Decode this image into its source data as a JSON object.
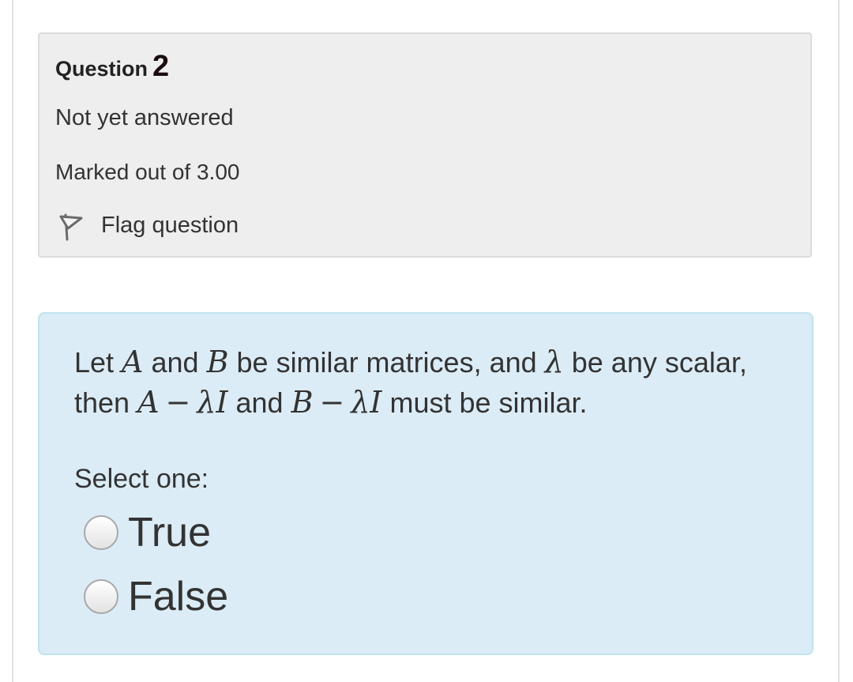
{
  "question": {
    "label": "Question",
    "number": "2",
    "state": "Not yet answered",
    "grade": "Marked out of 3.00",
    "flag_label": "Flag question"
  },
  "content": {
    "text": {
      "t1": "Let ",
      "A": "A",
      "t2": " and ",
      "B": "B",
      "t3": " be similar matrices, and ",
      "lambda": "λ",
      "t4": " be any scalar, then ",
      "A2": "A",
      "minus1": "−",
      "lambdaI1": "λI",
      "t5": " and ",
      "B2": "B",
      "minus2": "−",
      "lambdaI2": "λI",
      "t6": " must be similar."
    },
    "prompt": "Select one:",
    "options": [
      {
        "label": "True"
      },
      {
        "label": "False"
      }
    ]
  },
  "icons": {
    "flag": "flag-icon",
    "radio": "radio-button"
  },
  "colors": {
    "info_bg": "#eeeeee",
    "content_bg": "#dbecf6",
    "content_border": "#c1e3ee",
    "text": "#333333"
  }
}
